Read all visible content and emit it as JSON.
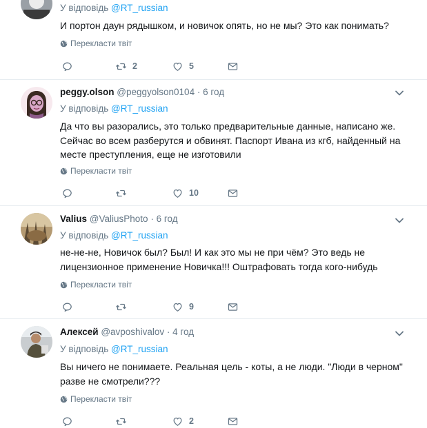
{
  "labels": {
    "reply_prefix": "У відповідь",
    "translate": "Перекласти твіт",
    "dot": "·"
  },
  "tweets": [
    {
      "name": "",
      "handle": "",
      "time": "",
      "reply_to": "@RT_russian",
      "text": "И портон даун рядышком, и новичок опять, но не мы? Это как понимать?",
      "replies": "",
      "retweets": "2",
      "likes": "5"
    },
    {
      "name": "peggy.olson",
      "handle": "@peggyolson0104",
      "time": "6 год",
      "reply_to": "@RT_russian",
      "text": "Да что вы разорались, это только предварительные данные, написано же. Сейчас во всем разберутся и обвинят. Паспорт Ивана из кгб, найденный на месте преступления, еще не изготовили",
      "replies": "",
      "retweets": "",
      "likes": "10"
    },
    {
      "name": "Valius",
      "handle": "@ValiusPhoto",
      "time": "6 год",
      "reply_to": "@RT_russian",
      "text": "не-не-не, Новичок был? Был! И как это мы не при чём? Это ведь не лицензионное применение Новичка!!! Оштрафовать тогда кого-нибудь",
      "replies": "",
      "retweets": "",
      "likes": "9"
    },
    {
      "name": "Алексей",
      "handle": "@avposhivalov",
      "time": "4 год",
      "reply_to": "@RT_russian",
      "text": "Вы ничего не понимаете. Реальная цель - коты, а не люди. \"Люди в черном\" разве не смотрели???",
      "replies": "",
      "retweets": "",
      "likes": "2"
    }
  ],
  "icons": {
    "reply": "reply-icon",
    "retweet": "retweet-icon",
    "like": "heart-icon",
    "dm": "envelope-icon",
    "caret": "chevron-down-icon",
    "globe": "globe-icon"
  },
  "colors": {
    "link": "#1da1f2",
    "secondary": "#657786",
    "separator": "#e6ecf0"
  }
}
